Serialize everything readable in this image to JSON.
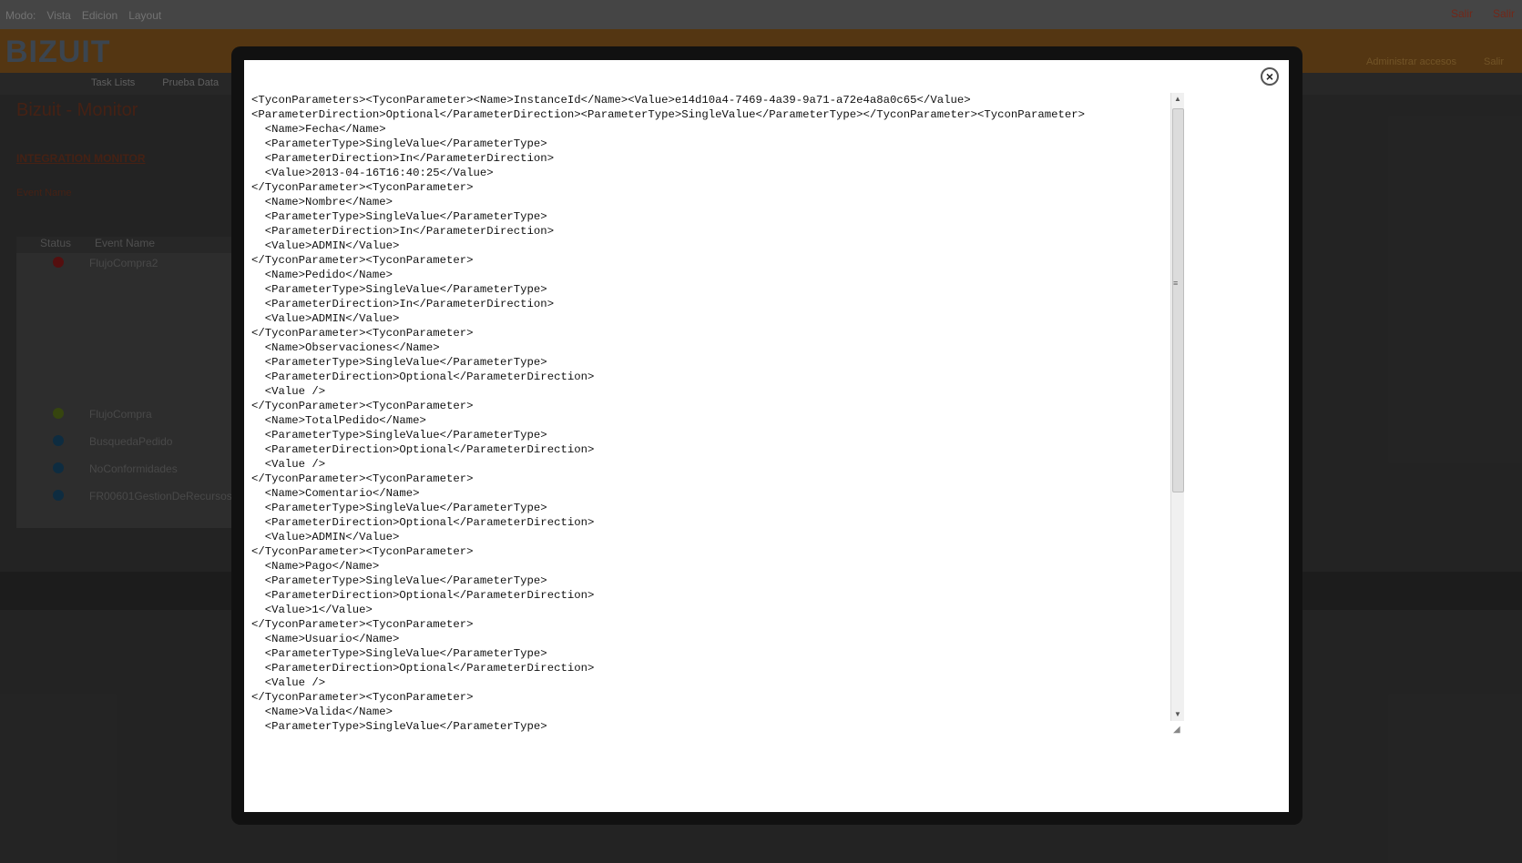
{
  "background": {
    "menu": [
      "Modo:",
      "Vista",
      "Edicion",
      "Layout"
    ],
    "top_right": [
      "Salir",
      "Salir"
    ],
    "logo": "BIZUIT",
    "banner_links": [
      "Administrar accesos",
      "Salir"
    ],
    "tabs": [
      "Task Lists",
      "Prueba Data"
    ],
    "page_title": "Bizuit - Monitor",
    "section_title": "INTEGRATION MONITOR",
    "filter_label": "Event Name",
    "table_headers": [
      "Status",
      "Event Name"
    ],
    "rows": [
      "FlujoCompra2",
      "FlujoCompra",
      "BusquedaPedido",
      "NoConformidades",
      "FR00601GestionDeRecursos"
    ]
  },
  "modal": {
    "close_label": "×",
    "xml_lines": [
      "<TyconParameters><TyconParameter><Name>InstanceId</Name><Value>e14d10a4-7469-4a39-9a71-a72e4a8a0c65</Value>",
      "<ParameterDirection>Optional</ParameterDirection><ParameterType>SingleValue</ParameterType></TyconParameter><TyconParameter>",
      "  <Name>Fecha</Name>",
      "  <ParameterType>SingleValue</ParameterType>",
      "  <ParameterDirection>In</ParameterDirection>",
      "  <Value>2013-04-16T16:40:25</Value>",
      "</TyconParameter><TyconParameter>",
      "  <Name>Nombre</Name>",
      "  <ParameterType>SingleValue</ParameterType>",
      "  <ParameterDirection>In</ParameterDirection>",
      "  <Value>ADMIN</Value>",
      "</TyconParameter><TyconParameter>",
      "  <Name>Pedido</Name>",
      "  <ParameterType>SingleValue</ParameterType>",
      "  <ParameterDirection>In</ParameterDirection>",
      "  <Value>ADMIN</Value>",
      "</TyconParameter><TyconParameter>",
      "  <Name>Observaciones</Name>",
      "  <ParameterType>SingleValue</ParameterType>",
      "  <ParameterDirection>Optional</ParameterDirection>",
      "  <Value />",
      "</TyconParameter><TyconParameter>",
      "  <Name>TotalPedido</Name>",
      "  <ParameterType>SingleValue</ParameterType>",
      "  <ParameterDirection>Optional</ParameterDirection>",
      "  <Value />",
      "</TyconParameter><TyconParameter>",
      "  <Name>Comentario</Name>",
      "  <ParameterType>SingleValue</ParameterType>",
      "  <ParameterDirection>Optional</ParameterDirection>",
      "  <Value>ADMIN</Value>",
      "</TyconParameter><TyconParameter>",
      "  <Name>Pago</Name>",
      "  <ParameterType>SingleValue</ParameterType>",
      "  <ParameterDirection>Optional</ParameterDirection>",
      "  <Value>1</Value>",
      "</TyconParameter><TyconParameter>",
      "  <Name>Usuario</Name>",
      "  <ParameterType>SingleValue</ParameterType>",
      "  <ParameterDirection>Optional</ParameterDirection>",
      "  <Value />",
      "</TyconParameter><TyconParameter>",
      "  <Name>Valida</Name>",
      "  <ParameterType>SingleValue</ParameterType>"
    ],
    "colors": {
      "overlay": "#262626",
      "modal_bg": "#ffffff",
      "frame": "#111111"
    }
  }
}
